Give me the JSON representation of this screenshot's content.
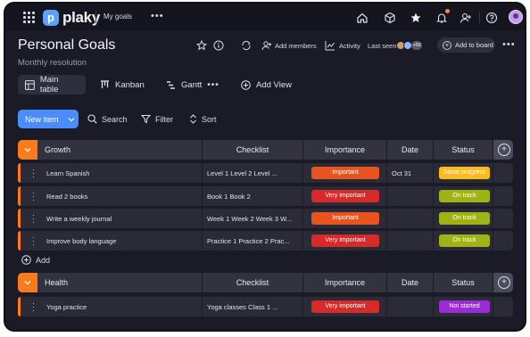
{
  "topbar": {
    "logo_text": "plaky",
    "workspace": "My goals",
    "more": "•••"
  },
  "board": {
    "title": "Personal Goals",
    "subtitle": "Monthly resolution",
    "add_members": "Add members",
    "activity": "Activity",
    "last_seen": "Last seen",
    "last_seen_count": "+50",
    "add_to_board": "Add to board",
    "more": "•••"
  },
  "views": {
    "main": "Main table",
    "kanban": "Kanban",
    "gantt": "Gantt",
    "gantt_more": "•••",
    "add_view": "Add View"
  },
  "toolbar": {
    "new_item": "New item",
    "search": "Search",
    "filter": "Filter",
    "sort": "Sort"
  },
  "columns": [
    "Checklist",
    "Importance",
    "Date",
    "Status"
  ],
  "groups": [
    {
      "name": "Growth",
      "color": "#ff7a1a",
      "items": [
        {
          "name": "Learn Spanish",
          "checklist": "Level 1 Level 2 Level ...",
          "importance": "Important",
          "date": "Oct 31",
          "status": "Some progress"
        },
        {
          "name": "Read 2 books",
          "checklist": "Book 1 Book 2",
          "importance": "Very important",
          "date": "",
          "status": "On track"
        },
        {
          "name": "Write a weekly journal",
          "checklist": "Week 1 Week 2 Week 3 W...",
          "importance": "Important",
          "date": "",
          "status": "On track"
        },
        {
          "name": "Improve body language",
          "checklist": "Practice 1 Practice 2 Prac...",
          "importance": "Very important",
          "date": "",
          "status": "On track"
        }
      ],
      "add_label": "Add"
    },
    {
      "name": "Health",
      "color": "#ff7a1a",
      "items": [
        {
          "name": "Yoga practice",
          "checklist": "Yoga classes Class 1 ...",
          "importance": "Very important",
          "date": "",
          "status": "Not started"
        }
      ]
    }
  ],
  "colors": {
    "important": "#e85420",
    "very_important": "#d92a2a",
    "some_progress": "#ffbb1a",
    "on_track": "#9fb317",
    "not_started": "#9b2bd6",
    "accent": "#4b8dff"
  }
}
